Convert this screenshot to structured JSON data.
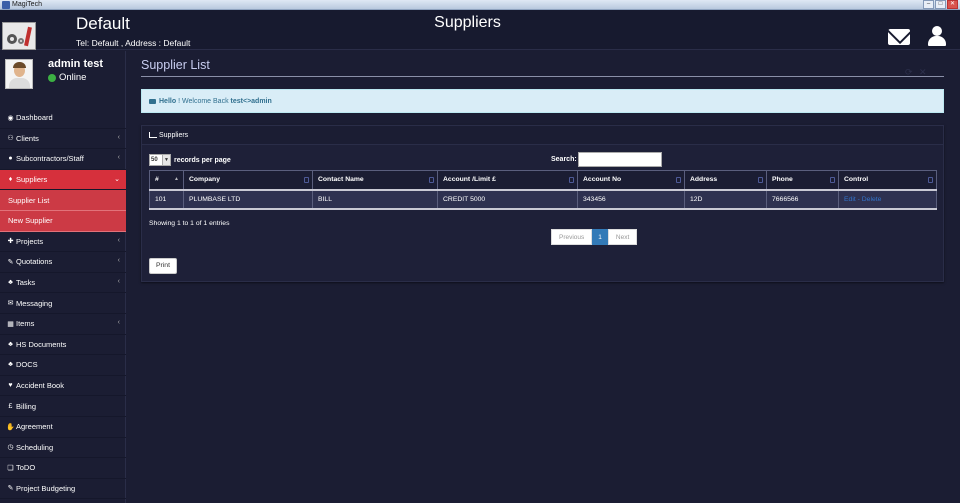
{
  "window": {
    "title": "MagiTech"
  },
  "header": {
    "site_name": "Default",
    "site_info": "Tel: Default , Address : Default",
    "page_title": "Suppliers"
  },
  "user": {
    "name": "admin test",
    "status": "Online"
  },
  "sidebar": {
    "items": [
      {
        "label": "Dashboard",
        "icon": "dashboard-icon",
        "glyph": "◉"
      },
      {
        "label": "Clients",
        "icon": "users-icon",
        "glyph": "⚇",
        "chevron": "‹"
      },
      {
        "label": "Subcontractors/Staff",
        "icon": "user-icon",
        "glyph": "●",
        "chevron": "‹"
      },
      {
        "label": "Suppliers",
        "icon": "suppliers-icon",
        "glyph": "♦",
        "chevron": "⌄"
      },
      {
        "label": "Supplier List"
      },
      {
        "label": "New Supplier"
      },
      {
        "label": "Projects",
        "icon": "pin-icon",
        "glyph": "✚",
        "chevron": "‹"
      },
      {
        "label": "Quotations",
        "icon": "wrench-icon",
        "glyph": "✎",
        "chevron": "‹"
      },
      {
        "label": "Tasks",
        "icon": "sitemap-icon",
        "glyph": "♣",
        "chevron": "‹"
      },
      {
        "label": "Messaging",
        "icon": "envelope-icon",
        "glyph": "✉"
      },
      {
        "label": "Items",
        "icon": "table-icon",
        "glyph": "▦",
        "chevron": "‹"
      },
      {
        "label": "HS Documents",
        "icon": "sitemap-icon",
        "glyph": "♣"
      },
      {
        "label": "DOCS",
        "icon": "sitemap-icon",
        "glyph": "♣"
      },
      {
        "label": "Accident Book",
        "icon": "heart-icon",
        "glyph": "♥"
      },
      {
        "label": "Billing",
        "icon": "pound-icon",
        "glyph": "£"
      },
      {
        "label": "Agreement",
        "icon": "thumbs-up-icon",
        "glyph": "✋"
      },
      {
        "label": "Scheduling",
        "icon": "clock-icon",
        "glyph": "◷"
      },
      {
        "label": "ToDO",
        "icon": "todo-icon",
        "glyph": "❏"
      },
      {
        "label": "Project Budgeting",
        "icon": "wrench-icon",
        "glyph": "✎"
      }
    ]
  },
  "main": {
    "title": "Supplier List",
    "alert": {
      "hello": "Hello",
      "welcome": "! Welcome Back",
      "username": "test<>admin"
    },
    "panel_title": "Suppliers",
    "length": {
      "value": "50",
      "label": "records per page"
    },
    "search": {
      "label": "Search:",
      "value": ""
    },
    "table": {
      "headers": [
        "#",
        "Company",
        "Contact Name",
        "Account /Limit £",
        "Account No",
        "Address",
        "Phone",
        "Control"
      ],
      "rows": [
        [
          "101",
          "PLUMBASE LTD",
          "BILL",
          "CREDIT 5000",
          "343456",
          "12D",
          "7666566"
        ]
      ],
      "row_actions": {
        "edit": "Edit",
        "separator": " - ",
        "delete": "Delete"
      }
    },
    "info": "Showing 1 to 1 of 1 entries",
    "pager": {
      "previous": "Previous",
      "current": "1",
      "next": "Next"
    },
    "print_label": "Print"
  },
  "colors": {
    "background": "#1b1d33",
    "accent": "#d6303c",
    "alert_bg": "#d9edf7",
    "link": "#3273c9"
  }
}
